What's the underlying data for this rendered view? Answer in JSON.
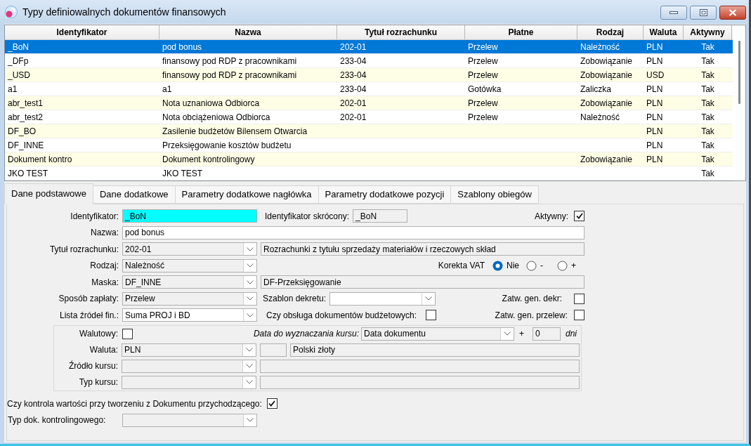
{
  "window": {
    "title": "Typy definiowalnych dokumentów finansowych"
  },
  "table": {
    "columns": [
      "Identyfikator",
      "Nazwa",
      "Tytuł rozrachunku",
      "Płatne",
      "Rodzaj",
      "Waluta",
      "Aktywny"
    ],
    "rows": [
      {
        "selected": true,
        "identyfikator": "_BoN",
        "nazwa": "pod bonus",
        "tytul_rozrachunku": "202-01",
        "platne": "Przelew",
        "rodzaj": "Należność",
        "waluta": "PLN",
        "aktywny": "Tak"
      },
      {
        "selected": false,
        "identyfikator": "_DFp",
        "nazwa": "finansowy pod RDP z pracownikami",
        "tytul_rozrachunku": "233-04",
        "platne": "Przelew",
        "rodzaj": "Zobowiązanie",
        "waluta": "PLN",
        "aktywny": "Tak"
      },
      {
        "selected": false,
        "identyfikator": "_USD",
        "nazwa": "finansowy pod RDP z pracownikami",
        "tytul_rozrachunku": "233-04",
        "platne": "Przelew",
        "rodzaj": "Zobowiązanie",
        "waluta": "USD",
        "aktywny": "Tak"
      },
      {
        "selected": false,
        "identyfikator": "a1",
        "nazwa": "a1",
        "tytul_rozrachunku": "233-04",
        "platne": "Gotówka",
        "rodzaj": "Zaliczka",
        "waluta": "PLN",
        "aktywny": "Tak"
      },
      {
        "selected": false,
        "identyfikator": "abr_test1",
        "nazwa": "Nota uznaniowa Odbiorca",
        "tytul_rozrachunku": "202-01",
        "platne": "Przelew",
        "rodzaj": "Zobowiązanie",
        "waluta": "PLN",
        "aktywny": "Tak"
      },
      {
        "selected": false,
        "identyfikator": "abr_test2",
        "nazwa": "Nota obciążeniowa Odbiorca",
        "tytul_rozrachunku": "202-01",
        "platne": "Przelew",
        "rodzaj": "Należność",
        "waluta": "PLN",
        "aktywny": "Tak"
      },
      {
        "selected": false,
        "identyfikator": "DF_BO",
        "nazwa": "Zasilenie budżetów Bilensem Otwarcia",
        "waluta": "PLN",
        "aktywny": "Tak"
      },
      {
        "selected": false,
        "identyfikator": "DF_INNE",
        "nazwa": "Przeksięgowanie kosztów budżetu",
        "waluta": "PLN",
        "aktywny": "Tak"
      },
      {
        "selected": false,
        "identyfikator": "Dokument kontro",
        "nazwa": "Dokument kontrolingowy",
        "rodzaj": "Zobowiązanie",
        "waluta": "PLN",
        "aktywny": "Tak"
      },
      {
        "selected": false,
        "identyfikator": "JKO TEST",
        "nazwa": "JKO TEST",
        "aktywny": "Tak"
      }
    ]
  },
  "tabs": [
    {
      "label": "Dane podstawowe",
      "selected": true
    },
    {
      "label": "Dane dodatkowe",
      "selected": false
    },
    {
      "label": "Parametry dodatkowe nagłówka",
      "selected": false
    },
    {
      "label": "Parametry dodatkowe pozycji",
      "selected": false
    },
    {
      "label": "Szablony obiegów",
      "selected": false
    }
  ],
  "form": {
    "identyfikator": {
      "label": "Identyfikator:",
      "value": "_BoN",
      "focused": true
    },
    "identyfikator_skrocony": {
      "label": "Identyfikator skrócony:",
      "value": "_BoN",
      "disabled": true
    },
    "aktywny": {
      "label": "Aktywny:",
      "checked": true
    },
    "nazwa": {
      "label": "Nazwa:",
      "value": "pod bonus",
      "disabled": false
    },
    "tytul_rozrachunku": {
      "label": "Tytuł rozrachunku:",
      "value": "202-01",
      "disabled": true,
      "description": "Rozrachunki z tytułu sprzedaży materiałów i rzeczowych skład"
    },
    "rodzaj": {
      "label": "Rodzaj:",
      "value": "Należność",
      "disabled": true
    },
    "korekta_vat": {
      "label": "Korekta VAT",
      "options": [
        {
          "label": "Nie",
          "selected": true
        },
        {
          "label": "-",
          "selected": false
        },
        {
          "label": "+",
          "selected": false
        }
      ]
    },
    "maska": {
      "label": "Maska:",
      "value": "DF_INNE",
      "disabled": true,
      "description": "DF-Przeksięgowanie"
    },
    "sposob_zaplaty": {
      "label": "Sposób zapłaty:",
      "value": "Przelew",
      "disabled": true
    },
    "szablon_dekretu": {
      "label": "Szablon dekretu:",
      "disabled": false
    },
    "zatw_gen_dekr": {
      "label": "Zatw. gen. dekr:",
      "checked": false
    },
    "lista_zrodel_fin": {
      "label": "Lista źródeł fin.:",
      "value": "Suma PROJ i BD",
      "disabled": false
    },
    "obsluga_dokumentow_budzetowych": {
      "label": "Czy obsługa dokumentów budżetowych:",
      "checked": false
    },
    "zatw_gen_przelew": {
      "label": "Zatw. gen. przelew:",
      "checked": false
    },
    "waluta_group": {
      "walutowy": {
        "label": "Walutowy:",
        "checked": false
      },
      "data_do_wyznaczania_kursu": {
        "label": "Data do wyznaczania kursu:",
        "value": "Data dokumentu",
        "disabled": true,
        "plus": "+",
        "days": "0",
        "days_disabled": true,
        "unit": "dni"
      },
      "waluta": {
        "label": "Waluta:",
        "value": "PLN",
        "disabled": true,
        "description": "Polski złoty"
      },
      "zrodlo_kursu": {
        "label": "Źródło kursu:",
        "disabled": true
      },
      "typ_kursu": {
        "label": "Typ kursu:",
        "disabled": true
      }
    },
    "kontrola_wartosci": {
      "label": "Czy kontrola wartości przy tworzeniu z Dokumentu przychodzącego:",
      "checked": true
    },
    "typ_dok_kontrolingowego": {
      "label": "Typ dok. kontrolingowego:",
      "disabled": true
    }
  }
}
